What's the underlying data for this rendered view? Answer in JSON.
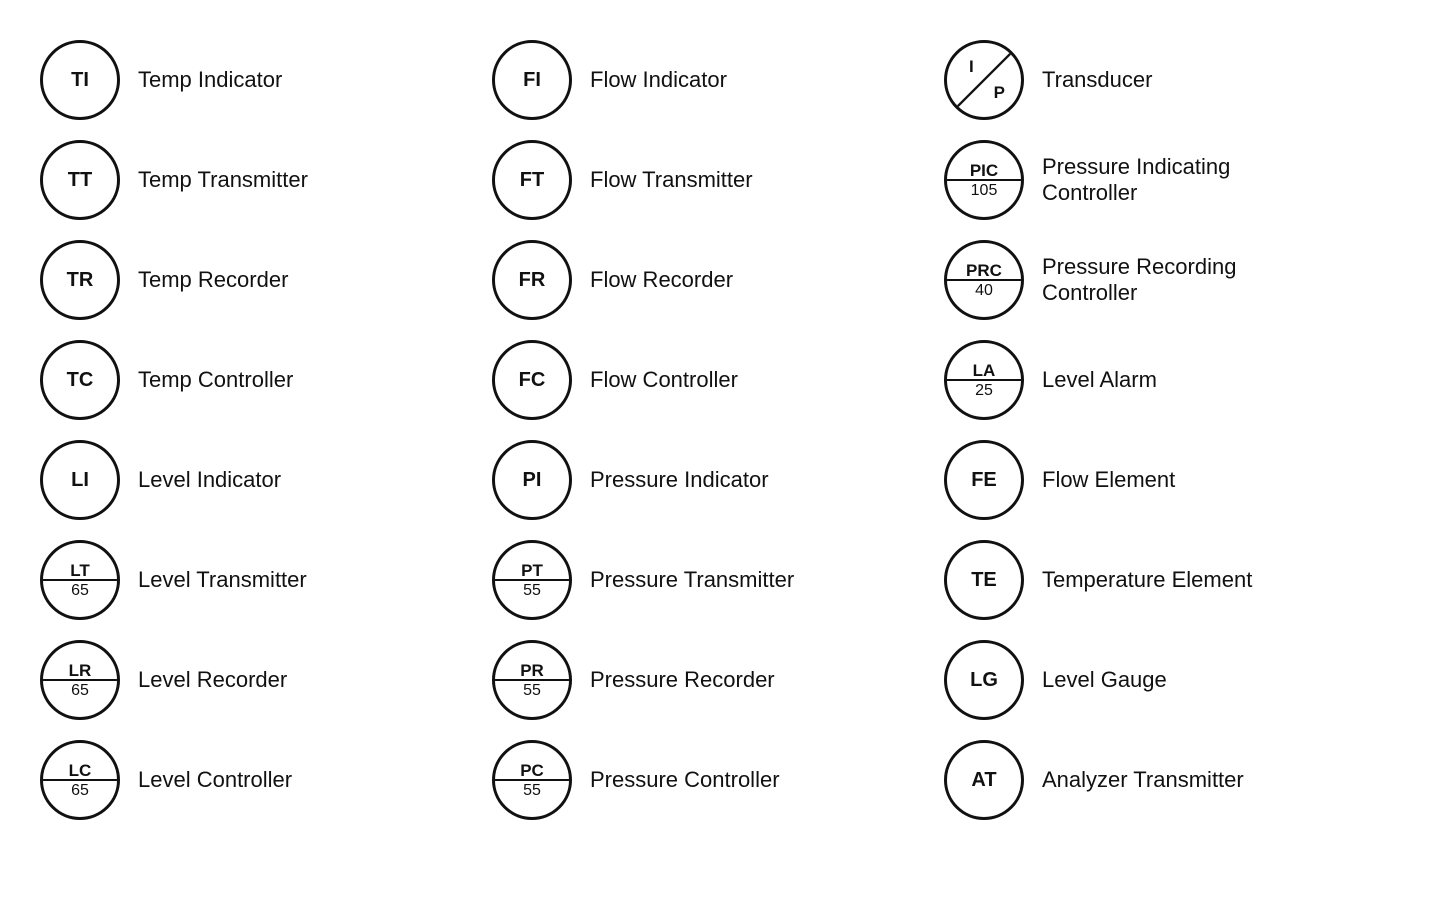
{
  "columns": [
    {
      "id": "col1",
      "rows": [
        {
          "id": "TI",
          "type": "simple",
          "top": "TI",
          "bottom": "",
          "label": "Temp Indicator"
        },
        {
          "id": "TT",
          "type": "simple",
          "top": "TT",
          "bottom": "",
          "label": "Temp Transmitter"
        },
        {
          "id": "TR",
          "type": "simple",
          "top": "TR",
          "bottom": "",
          "label": "Temp Recorder"
        },
        {
          "id": "TC",
          "type": "simple",
          "top": "TC",
          "bottom": "",
          "label": "Temp Controller"
        },
        {
          "id": "LI",
          "type": "simple",
          "top": "LI",
          "bottom": "",
          "label": "Level Indicator"
        },
        {
          "id": "LT",
          "type": "divided",
          "top": "LT",
          "bottom": "65",
          "label": "Level Transmitter"
        },
        {
          "id": "LR",
          "type": "divided",
          "top": "LR",
          "bottom": "65",
          "label": "Level Recorder"
        },
        {
          "id": "LC",
          "type": "divided",
          "top": "LC",
          "bottom": "65",
          "label": "Level Controller"
        }
      ]
    },
    {
      "id": "col2",
      "rows": [
        {
          "id": "FI",
          "type": "simple",
          "top": "FI",
          "bottom": "",
          "label": "Flow Indicator"
        },
        {
          "id": "FT",
          "type": "simple",
          "top": "FT",
          "bottom": "",
          "label": "Flow Transmitter"
        },
        {
          "id": "FR",
          "type": "simple",
          "top": "FR",
          "bottom": "",
          "label": "Flow Recorder"
        },
        {
          "id": "FC",
          "type": "simple",
          "top": "FC",
          "bottom": "",
          "label": "Flow Controller"
        },
        {
          "id": "PI",
          "type": "simple",
          "top": "PI",
          "bottom": "",
          "label": "Pressure Indicator"
        },
        {
          "id": "PT",
          "type": "divided",
          "top": "PT",
          "bottom": "55",
          "label": "Pressure Transmitter"
        },
        {
          "id": "PR",
          "type": "divided",
          "top": "PR",
          "bottom": "55",
          "label": "Pressure Recorder"
        },
        {
          "id": "PC",
          "type": "divided",
          "top": "PC",
          "bottom": "55",
          "label": "Pressure Controller"
        }
      ]
    },
    {
      "id": "col3",
      "rows": [
        {
          "id": "IP",
          "type": "transducer",
          "top": "I",
          "bottom": "P",
          "label": "Transducer"
        },
        {
          "id": "PIC",
          "type": "divided",
          "top": "PIC",
          "bottom": "105",
          "label": "Pressure Indicating\nController"
        },
        {
          "id": "PRC",
          "type": "divided",
          "top": "PRC",
          "bottom": "40",
          "label": "Pressure Recording\nController"
        },
        {
          "id": "LA",
          "type": "divided",
          "top": "LA",
          "bottom": "25",
          "label": "Level Alarm"
        },
        {
          "id": "FE",
          "type": "simple",
          "top": "FE",
          "bottom": "",
          "label": "Flow Element"
        },
        {
          "id": "TE",
          "type": "simple",
          "top": "TE",
          "bottom": "",
          "label": "Temperature Element"
        },
        {
          "id": "LG",
          "type": "simple",
          "top": "LG",
          "bottom": "",
          "label": "Level Gauge"
        },
        {
          "id": "AT",
          "type": "simple",
          "top": "AT",
          "bottom": "",
          "label": "Analyzer Transmitter"
        }
      ]
    }
  ]
}
